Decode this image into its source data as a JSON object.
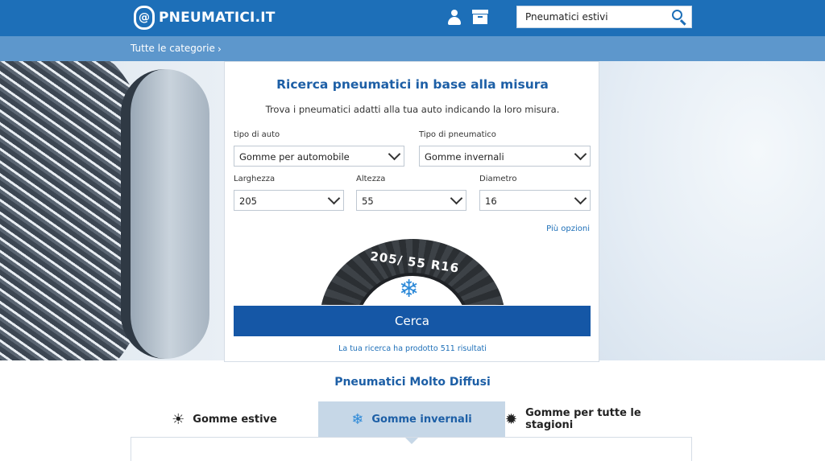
{
  "header": {
    "logo_text": "PNEUMATICI.IT",
    "logo_mark": "@",
    "search_value": "Pneumatici estivi",
    "icons": [
      "user-icon",
      "box-icon",
      "search-icon"
    ],
    "brand_color": "#1d6fb8"
  },
  "catbar": {
    "link_label": "Tutte le categorie",
    "chevron": "›"
  },
  "form": {
    "title": "Ricerca pneumatici in base alla misura",
    "subtitle": "Trova i pneumatici adatti alla tua auto indicando la loro misura.",
    "car_type_label": "tipo di auto",
    "car_type_value": "Gomme per automobile",
    "tire_type_label": "Tipo di pneumatico",
    "tire_type_value": "Gomme invernali",
    "width_label": "Larghezza",
    "width_value": "205",
    "height_label": "Altezza",
    "height_value": "55",
    "diameter_label": "Diametro",
    "diameter_value": "16",
    "more_options": "Più opzioni",
    "tire_size_text": "205/ 55 R16",
    "submit_label": "Cerca",
    "result_note": "La tua ricerca ha prodotto 511 risultati"
  },
  "popular": {
    "title": "Pneumatici Molto Diffusi",
    "tabs": [
      {
        "label": "Gomme estive",
        "icon": "sun-icon",
        "glyph": "☀",
        "active": false
      },
      {
        "label": "Gomme invernali",
        "icon": "snowflake-icon",
        "glyph": "❄",
        "active": true
      },
      {
        "label": "Gomme per tutte le stagioni",
        "icon": "sun-snow-icon",
        "glyph": "✹",
        "active": false
      }
    ]
  }
}
